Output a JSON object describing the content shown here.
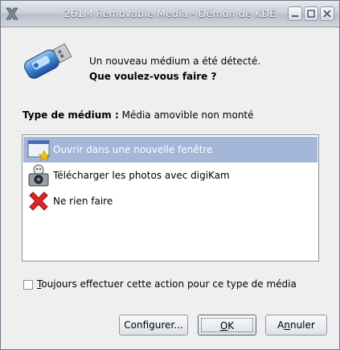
{
  "window": {
    "title": "261M Removable Media - Démon de KDE"
  },
  "message": {
    "line1": "Un nouveau médium a été détecté.",
    "line2": "Que voulez-vous faire ?"
  },
  "media_type": {
    "label": "Type de médium :",
    "value": "Média amovible non monté"
  },
  "actions": [
    {
      "label": "Ouvrir dans une nouvelle fenêtre",
      "icon": "folder-window-icon",
      "selected": true
    },
    {
      "label": "Télécharger les photos avec digiKam",
      "icon": "camera-icon",
      "selected": false
    },
    {
      "label": "Ne rien faire",
      "icon": "red-cross-icon",
      "selected": false
    }
  ],
  "checkbox": {
    "mnemonic": "T",
    "rest": "oujours effectuer cette action pour ce type de média",
    "checked": false
  },
  "buttons": {
    "configure": "Configurer...",
    "ok_mnemonic": "O",
    "ok_rest": "K",
    "cancel_mnemonic": "n",
    "cancel_pre": "A",
    "cancel_rest": "nuler"
  },
  "colors": {
    "selection": "#a4b7d8",
    "titlebar": "#c8ced6",
    "window_bg": "#efefef"
  }
}
